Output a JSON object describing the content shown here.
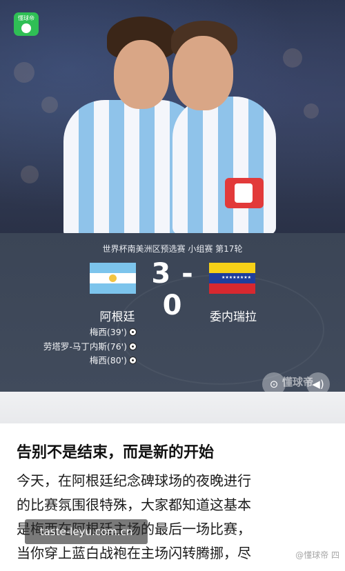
{
  "app_badge": {
    "label": "懂球帝"
  },
  "match": {
    "competition": "世界杯南美洲区预选赛 小组赛 第17轮",
    "score": "3 - 0",
    "home_team": "阿根廷",
    "away_team": "委内瑞拉",
    "scorers": [
      {
        "text": "梅西(39')",
        "icon": "football-icon"
      },
      {
        "text": "劳塔罗-马丁内斯(76')",
        "icon": "football-icon"
      },
      {
        "text": "梅西(80')",
        "icon": "football-icon"
      }
    ]
  },
  "media_controls": {
    "search_icon": "lens-search-icon",
    "volume_icon": "speaker-icon",
    "watermark": "懂球帝"
  },
  "article": {
    "headline": "告别不是结束，而是新的开始",
    "lines": [
      "今天，在阿根廷纪念碑球场的夜晚进行",
      "的比赛氛围很特殊，大家都知道这基本",
      "是梅西在阿根廷主场的最后一场比赛，",
      "当你穿上蓝白战袍在主场闪转腾挪，尽"
    ]
  },
  "overlays": {
    "site": "taste-leyu.com.cn",
    "right_watermark": "@懂球帝 四"
  },
  "colors": {
    "panel_bg": "#3b4556",
    "argentina_blue": "#7cc4ec",
    "venezuela_yellow": "#f7d117",
    "venezuela_blue": "#1f3e9c",
    "venezuela_red": "#d7282f",
    "badge_green": "#2fbf55"
  }
}
